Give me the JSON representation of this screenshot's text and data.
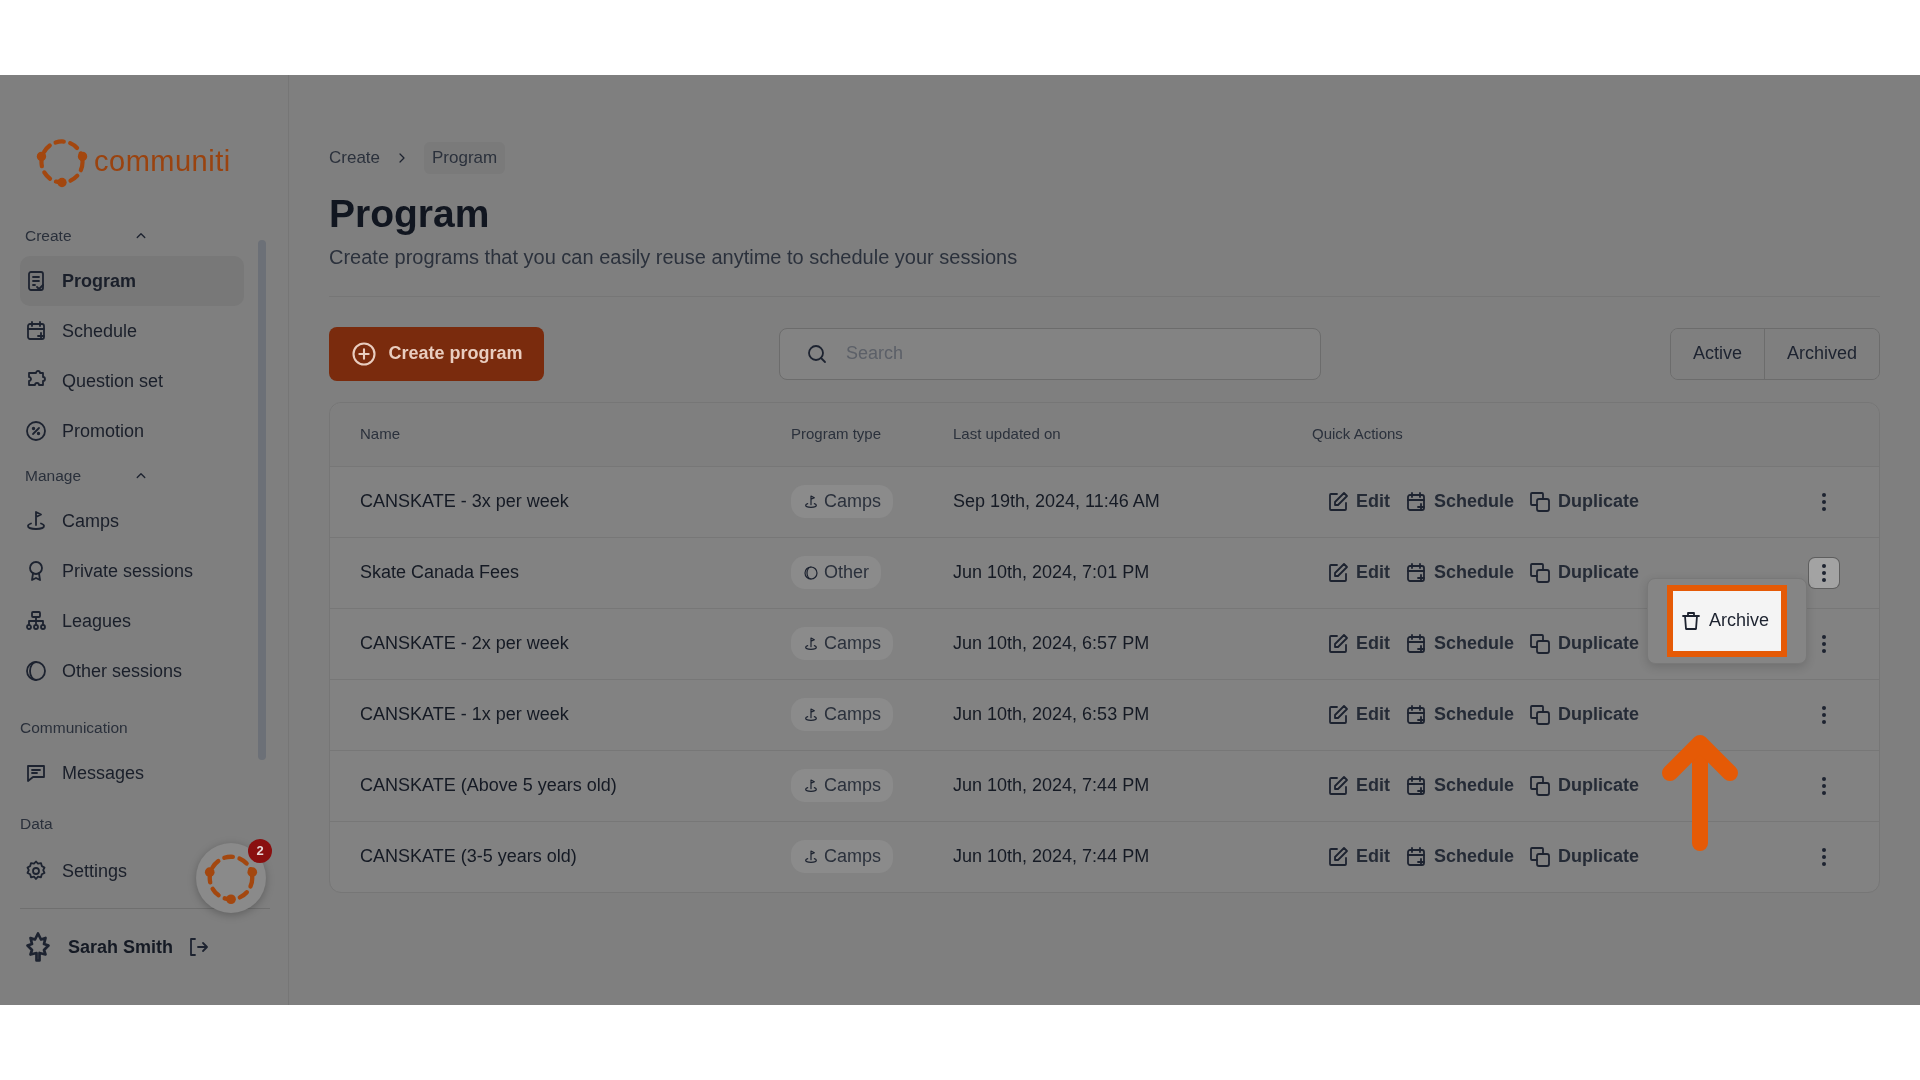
{
  "sidebar": {
    "logo_text": "communiti",
    "sections": [
      {
        "title": "Create",
        "kind": "group",
        "expanded": true,
        "items": [
          {
            "label": "Program",
            "selected": true
          },
          {
            "label": "Schedule",
            "selected": false
          },
          {
            "label": "Question set",
            "selected": false
          },
          {
            "label": "Promotion",
            "selected": false
          }
        ]
      },
      {
        "title": "Manage",
        "kind": "group",
        "expanded": true,
        "items": [
          {
            "label": "Camps",
            "selected": false
          },
          {
            "label": "Private sessions",
            "selected": false
          },
          {
            "label": "Leagues",
            "selected": false
          },
          {
            "label": "Other sessions",
            "selected": false
          }
        ]
      },
      {
        "title": "Communication",
        "kind": "heading",
        "items": [
          {
            "label": "Messages",
            "selected": false
          }
        ]
      },
      {
        "title": "Data",
        "kind": "heading"
      }
    ],
    "settings": "Settings",
    "user": {
      "name": "Sarah Smith"
    },
    "widget": {
      "badge": "2"
    }
  },
  "breadcrumb": [
    "Create",
    "Program"
  ],
  "page": {
    "title": "Program",
    "subtitle": "Create programs that you can easily reuse anytime to schedule your sessions"
  },
  "create_button": "Create program",
  "search": {
    "placeholder": "Search"
  },
  "filter_tabs": [
    "Active",
    "Archived"
  ],
  "table": {
    "columns": [
      "Name",
      "Program type",
      "Last updated on",
      "Quick Actions"
    ],
    "rows": [
      {
        "name": "CANSKATE - 3x per week",
        "type": {
          "kind": "camps",
          "label": "Camps"
        },
        "updated": "Sep 19th, 2024, 11:46 AM",
        "actions": [
          "Edit",
          "Schedule",
          "Duplicate"
        ],
        "menu_open": false
      },
      {
        "name": "Skate Canada Fees",
        "type": {
          "kind": "other",
          "label": "Other"
        },
        "updated": "Jun 10th, 2024, 7:01 PM",
        "actions": [
          "Edit",
          "Schedule",
          "Duplicate"
        ],
        "menu_open": true
      },
      {
        "name": "CANSKATE - 2x per week",
        "type": {
          "kind": "camps",
          "label": "Camps"
        },
        "updated": "Jun 10th, 2024, 6:57 PM",
        "actions": [
          "Edit",
          "Schedule",
          "Duplicate"
        ],
        "menu_open": false
      },
      {
        "name": "CANSKATE - 1x per week",
        "type": {
          "kind": "camps",
          "label": "Camps"
        },
        "updated": "Jun 10th, 2024, 6:53 PM",
        "actions": [
          "Edit",
          "Schedule",
          "Duplicate"
        ],
        "menu_open": false
      },
      {
        "name": "CANSKATE (Above 5 years old)",
        "type": {
          "kind": "camps",
          "label": "Camps"
        },
        "updated": "Jun 10th, 2024, 7:44 PM",
        "actions": [
          "Edit",
          "Schedule",
          "Duplicate"
        ],
        "menu_open": false
      },
      {
        "name": "CANSKATE (3-5 years old)",
        "type": {
          "kind": "camps",
          "label": "Camps"
        },
        "updated": "Jun 10th, 2024, 7:44 PM",
        "actions": [
          "Edit",
          "Schedule",
          "Duplicate"
        ],
        "menu_open": false
      }
    ]
  },
  "row_menu": {
    "items": [
      {
        "label": "Archive",
        "highlighted": true
      }
    ]
  }
}
